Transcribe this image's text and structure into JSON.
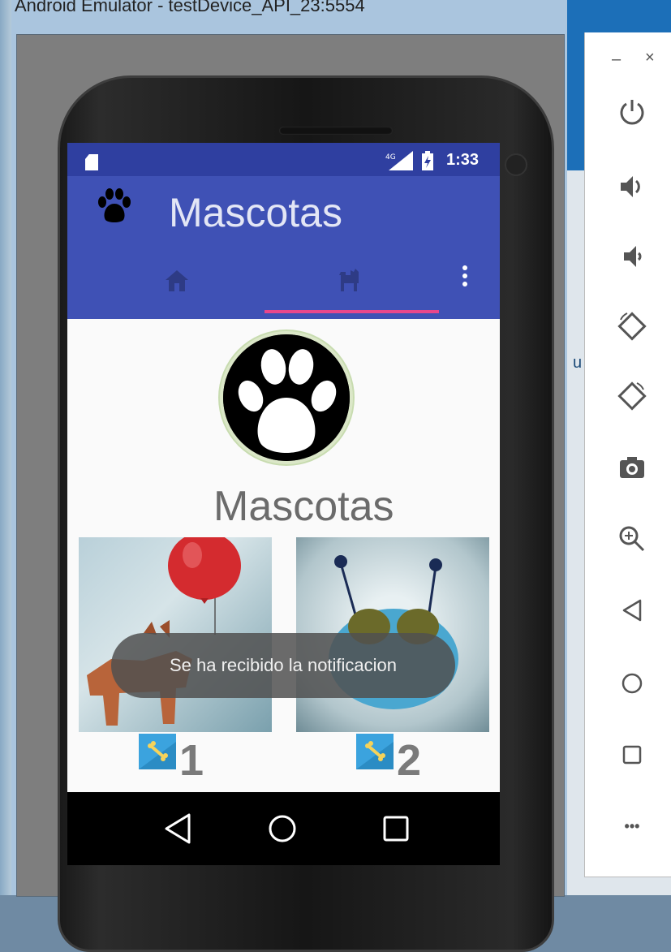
{
  "window": {
    "title": "Android Emulator - testDevice_API_23:5554"
  },
  "desktop": {
    "peek_text": "u"
  },
  "status_bar": {
    "network": "4G",
    "time": "1:33"
  },
  "toolbar": {
    "title": "Mascotas",
    "logo_icon": "paw-icon"
  },
  "tabs": [
    {
      "icon": "home-icon",
      "selected": false
    },
    {
      "icon": "dog-icon",
      "selected": true
    }
  ],
  "profile": {
    "name": "Mascotas",
    "avatar_icon": "paw-icon"
  },
  "pets": [
    {
      "image": "dog-with-red-balloon",
      "icon": "bone-icon",
      "rating": "1"
    },
    {
      "image": "blue-creature-with-antennae",
      "icon": "bone-icon",
      "rating": "2"
    }
  ],
  "toast": {
    "message": "Se ha recibido la notificacion"
  },
  "side_panel": {
    "minimize": "–",
    "close": "×",
    "buttons": [
      "power-icon",
      "volume-up-icon",
      "volume-down-icon",
      "rotate-left-icon",
      "rotate-right-icon",
      "camera-icon",
      "zoom-in-icon",
      "back-icon",
      "home-icon",
      "overview-icon",
      "more-icon"
    ],
    "more_label": "•••"
  },
  "colors": {
    "primary": "#3f51b5",
    "primary_dark": "#2f3fa0",
    "accent": "#e8478c",
    "badge": "#3ba3de"
  }
}
